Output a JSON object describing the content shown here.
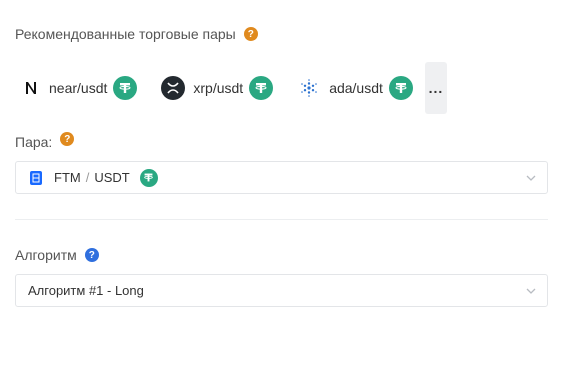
{
  "recommended": {
    "label": "Рекомендованные торговые пары",
    "help": "?",
    "pairs": [
      {
        "label": "near/usdt",
        "base_icon": "near-icon",
        "quote_icon": "tether-icon"
      },
      {
        "label": "xrp/usdt",
        "base_icon": "xrp-icon",
        "quote_icon": "tether-icon"
      },
      {
        "label": "ada/usdt",
        "base_icon": "cardano-icon",
        "quote_icon": "tether-icon"
      }
    ],
    "more_label": "..."
  },
  "pair": {
    "label": "Пара:",
    "help": "?",
    "base": "FTM",
    "separator": "/",
    "quote": "USDT"
  },
  "algorithm": {
    "label": "Алгоритм",
    "help": "?",
    "value": "Алгоритм #1 - Long"
  },
  "colors": {
    "help_orange": "#e08a1e",
    "help_blue": "#2f6fde",
    "tether_green": "#2aa882",
    "fantom_blue": "#1969ff"
  }
}
